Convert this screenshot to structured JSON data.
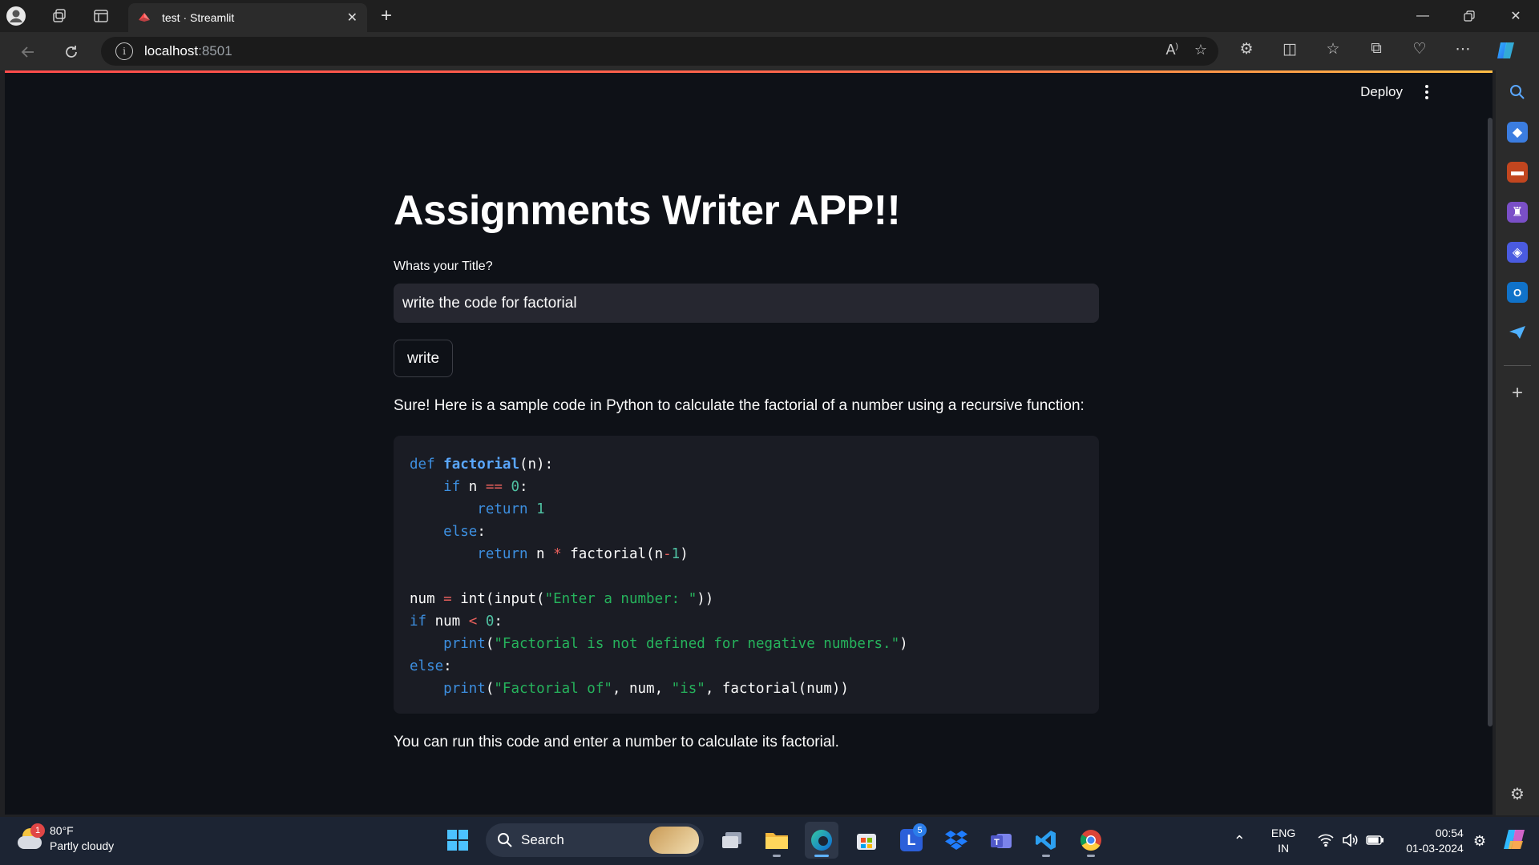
{
  "browser": {
    "tab_title": "test · Streamlit",
    "url_host": "localhost",
    "url_port": ":8501"
  },
  "app": {
    "deploy_label": "Deploy",
    "title": "Assignments Writer APP!!",
    "input_label": "Whats your Title?",
    "input_value": "write the code for factorial",
    "button_label": "write",
    "intro": "Sure! Here is a sample code in Python to calculate the factorial of a number using a recursive function:",
    "code": [
      "def factorial(n):",
      "    if n == 0:",
      "        return 1",
      "    else:",
      "        return n * factorial(n-1)",
      "",
      "num = int(input(\"Enter a number: \"))",
      "if num < 0:",
      "    print(\"Factorial is not defined for negative numbers.\")",
      "else:",
      "    print(\"Factorial of\", num, \"is\", factorial(num))"
    ],
    "outro": "You can run this code and enter a number to calculate its factorial."
  },
  "taskbar": {
    "weather_temp": "80°F",
    "weather_desc": "Partly cloudy",
    "weather_badge": "1",
    "search_label": "Search",
    "lang_top": "ENG",
    "lang_bottom": "IN",
    "time": "00:54",
    "date": "01-03-2024",
    "teams_badge": "5"
  },
  "colors": {
    "streamlit_accent": "#ff4b4b",
    "page_bg": "#0e1117",
    "input_bg": "#262730",
    "code_bg": "#1a1c24"
  }
}
